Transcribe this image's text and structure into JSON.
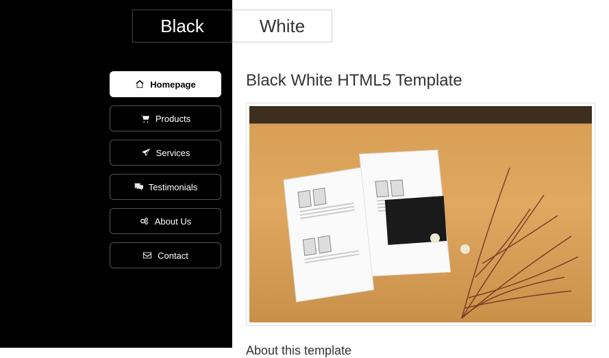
{
  "logo": {
    "black": "Black",
    "white": "White"
  },
  "nav": {
    "items": [
      {
        "label": "Homepage"
      },
      {
        "label": "Products"
      },
      {
        "label": "Services"
      },
      {
        "label": "Testimonials"
      },
      {
        "label": "About Us"
      },
      {
        "label": "Contact"
      }
    ]
  },
  "content": {
    "title": "Black White HTML5 Template",
    "subtitle": "About this template"
  }
}
